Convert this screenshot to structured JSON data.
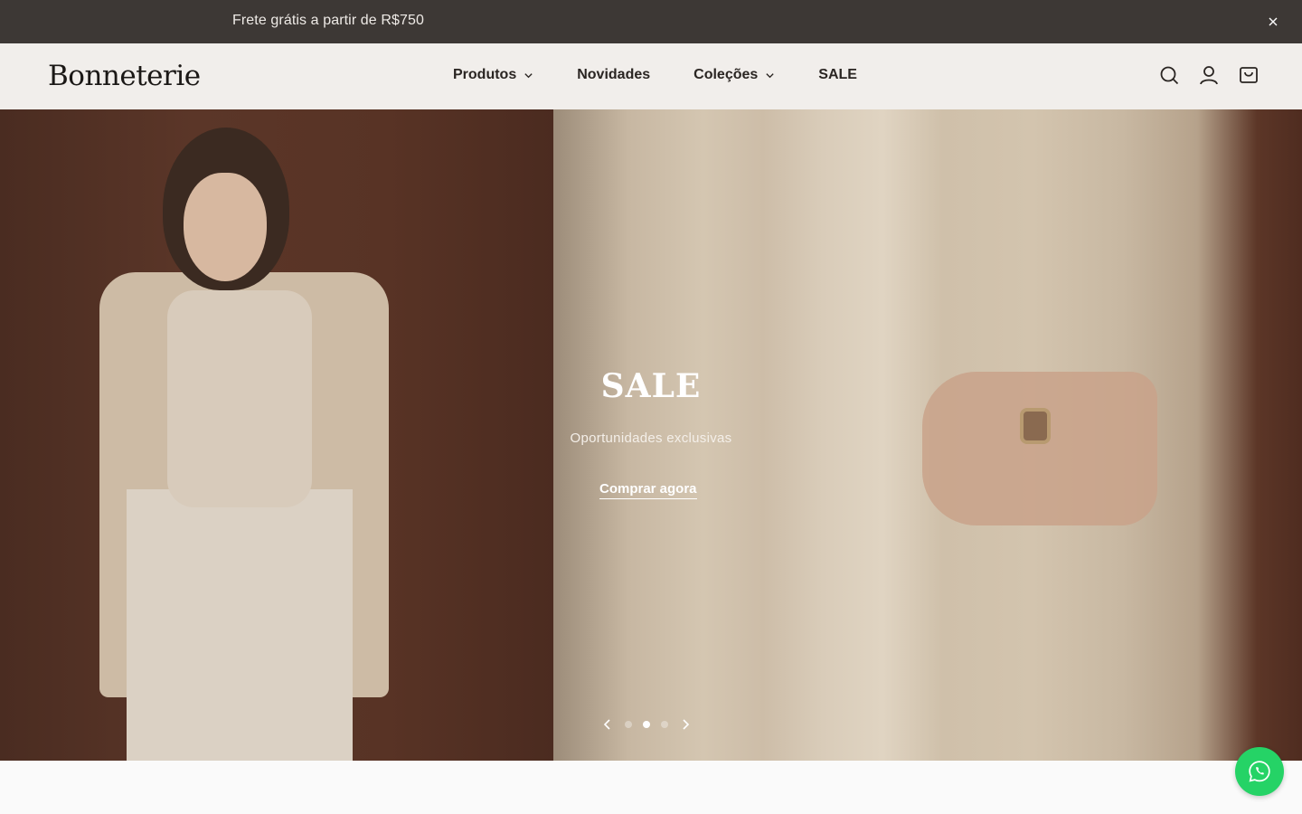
{
  "announcement": {
    "text": "Frete grátis a partir de R$750"
  },
  "header": {
    "logo": "Bonneterie",
    "nav": [
      {
        "label": "Produtos",
        "has_dropdown": true
      },
      {
        "label": "Novidades",
        "has_dropdown": false
      },
      {
        "label": "Coleções",
        "has_dropdown": true
      },
      {
        "label": "SALE",
        "has_dropdown": false
      }
    ],
    "icons": [
      "search-icon",
      "account-icon",
      "cart-icon"
    ]
  },
  "hero": {
    "title": "SALE",
    "subtitle": "Oportunidades exclusivas",
    "cta": "Comprar agora",
    "slide_count": 3,
    "active_slide": 2
  },
  "colors": {
    "announcement_bg": "#3d3835",
    "header_bg": "#f1eeeb",
    "whatsapp": "#25d366"
  }
}
